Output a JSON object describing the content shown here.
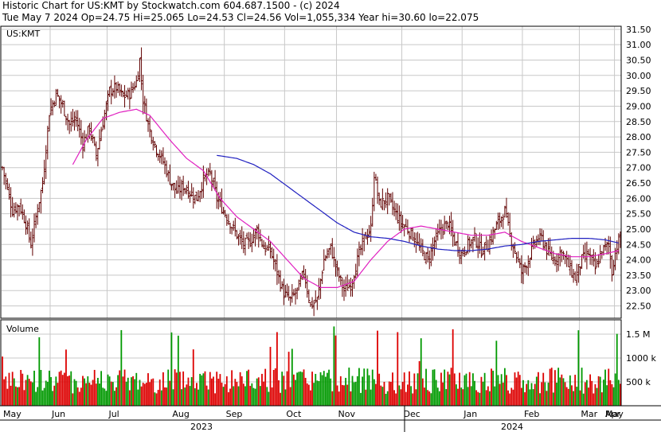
{
  "header": {
    "line1": "Historic Chart for US:KMT by Stockwatch.com 604.687.1500 - (c) 2024",
    "line2": "Tue May  7 2024   Op=24.75  Hi=25.065  Lo=24.53  Cl=24.56  Vol=1,055,334  Year hi=30.60  lo=22.075"
  },
  "symbol_label": "US:KMT",
  "volume_label": "Volume",
  "colors": {
    "price_bar": "#600000",
    "ma_short": "#e020c0",
    "ma_long": "#2020c0",
    "vol_up": "#009900",
    "vol_down": "#dd0000",
    "grid": "#c8c8c8"
  },
  "chart_data": {
    "type": "ohlc",
    "title": "Historic Chart for US:KMT",
    "y_ticks": [
      "31.50",
      "31.00",
      "30.50",
      "30.00",
      "29.50",
      "29.00",
      "28.50",
      "28.00",
      "27.50",
      "27.00",
      "26.50",
      "26.00",
      "25.50",
      "25.00",
      "24.50",
      "24.00",
      "23.50",
      "23.00",
      "22.50"
    ],
    "ylim": [
      22.1,
      31.6
    ],
    "volume_ticks": [
      "1.5 M",
      "1000 k",
      "500 k"
    ],
    "volume_ylim": [
      0,
      1800
    ],
    "x_month_labels": [
      "May",
      "Jun",
      "Jul",
      "Aug",
      "Sep",
      "Oct",
      "Nov",
      "Dec",
      "Jan",
      "Feb",
      "Mar",
      "Apr",
      "May"
    ],
    "year_labels": [
      "2023",
      "2024"
    ],
    "grid": true,
    "price_keypoints": [
      [
        0,
        27.0
      ],
      [
        6,
        25.6
      ],
      [
        10,
        25.8
      ],
      [
        14,
        25.2
      ],
      [
        17,
        24.5
      ],
      [
        20,
        25.4
      ],
      [
        24,
        26.5
      ],
      [
        28,
        28.8
      ],
      [
        32,
        29.4
      ],
      [
        36,
        29.0
      ],
      [
        40,
        28.4
      ],
      [
        44,
        28.6
      ],
      [
        48,
        27.8
      ],
      [
        52,
        28.3
      ],
      [
        56,
        27.4
      ],
      [
        60,
        28.5
      ],
      [
        64,
        29.5
      ],
      [
        68,
        29.6
      ],
      [
        72,
        29.3
      ],
      [
        76,
        29.4
      ],
      [
        80,
        29.8
      ],
      [
        82,
        30.5
      ],
      [
        84,
        29.2
      ],
      [
        88,
        28.2
      ],
      [
        92,
        27.6
      ],
      [
        96,
        27.2
      ],
      [
        100,
        26.6
      ],
      [
        104,
        26.2
      ],
      [
        108,
        26.4
      ],
      [
        112,
        26.2
      ],
      [
        116,
        26.0
      ],
      [
        120,
        26.6
      ],
      [
        124,
        26.8
      ],
      [
        128,
        26.0
      ],
      [
        132,
        25.6
      ],
      [
        136,
        25.2
      ],
      [
        140,
        24.8
      ],
      [
        144,
        24.5
      ],
      [
        148,
        24.6
      ],
      [
        152,
        25.0
      ],
      [
        156,
        24.4
      ],
      [
        160,
        24.3
      ],
      [
        164,
        23.6
      ],
      [
        168,
        22.9
      ],
      [
        172,
        22.7
      ],
      [
        176,
        23.0
      ],
      [
        180,
        23.6
      ],
      [
        184,
        22.5
      ],
      [
        188,
        22.7
      ],
      [
        192,
        24.0
      ],
      [
        196,
        24.4
      ],
      [
        200,
        23.6
      ],
      [
        204,
        23.0
      ],
      [
        208,
        23.2
      ],
      [
        212,
        24.0
      ],
      [
        216,
        24.7
      ],
      [
        220,
        25.0
      ],
      [
        222,
        26.8
      ],
      [
        225,
        25.8
      ],
      [
        230,
        26.0
      ],
      [
        234,
        25.6
      ],
      [
        238,
        25.2
      ],
      [
        242,
        25.0
      ],
      [
        246,
        24.7
      ],
      [
        250,
        24.3
      ],
      [
        254,
        24.0
      ],
      [
        258,
        24.6
      ],
      [
        262,
        25.0
      ],
      [
        266,
        25.2
      ],
      [
        270,
        24.6
      ],
      [
        274,
        24.2
      ],
      [
        278,
        24.5
      ],
      [
        282,
        24.7
      ],
      [
        286,
        24.3
      ],
      [
        290,
        24.5
      ],
      [
        294,
        25.0
      ],
      [
        298,
        25.4
      ],
      [
        300,
        25.6
      ],
      [
        303,
        24.8
      ],
      [
        306,
        24.3
      ],
      [
        310,
        23.6
      ],
      [
        314,
        24.0
      ],
      [
        318,
        24.6
      ],
      [
        322,
        24.7
      ],
      [
        326,
        24.2
      ],
      [
        330,
        24.0
      ],
      [
        334,
        24.3
      ],
      [
        338,
        23.8
      ],
      [
        342,
        23.4
      ],
      [
        346,
        24.0
      ],
      [
        350,
        24.2
      ],
      [
        354,
        23.7
      ],
      [
        358,
        24.3
      ],
      [
        362,
        24.5
      ],
      [
        364,
        23.6
      ],
      [
        366,
        24.3
      ],
      [
        368,
        24.6
      ]
    ],
    "ma_short_keypoints": [
      [
        42,
        27.1
      ],
      [
        50,
        27.9
      ],
      [
        60,
        28.6
      ],
      [
        70,
        28.8
      ],
      [
        80,
        28.9
      ],
      [
        88,
        28.7
      ],
      [
        100,
        27.9
      ],
      [
        110,
        27.3
      ],
      [
        120,
        26.9
      ],
      [
        130,
        26.0
      ],
      [
        140,
        25.4
      ],
      [
        150,
        25.0
      ],
      [
        160,
        24.6
      ],
      [
        170,
        24.0
      ],
      [
        180,
        23.4
      ],
      [
        190,
        23.1
      ],
      [
        200,
        23.1
      ],
      [
        210,
        23.3
      ],
      [
        220,
        24.0
      ],
      [
        230,
        24.6
      ],
      [
        240,
        25.0
      ],
      [
        250,
        25.1
      ],
      [
        260,
        25.0
      ],
      [
        270,
        24.9
      ],
      [
        280,
        24.8
      ],
      [
        290,
        24.8
      ],
      [
        300,
        24.9
      ],
      [
        310,
        24.6
      ],
      [
        320,
        24.4
      ],
      [
        330,
        24.2
      ],
      [
        340,
        24.1
      ],
      [
        350,
        24.1
      ],
      [
        360,
        24.2
      ],
      [
        368,
        24.3
      ]
    ],
    "ma_long_keypoints": [
      [
        128,
        27.4
      ],
      [
        140,
        27.3
      ],
      [
        150,
        27.1
      ],
      [
        160,
        26.8
      ],
      [
        170,
        26.4
      ],
      [
        180,
        26.0
      ],
      [
        190,
        25.6
      ],
      [
        200,
        25.2
      ],
      [
        210,
        24.9
      ],
      [
        220,
        24.75
      ],
      [
        230,
        24.7
      ],
      [
        240,
        24.6
      ],
      [
        250,
        24.45
      ],
      [
        260,
        24.35
      ],
      [
        270,
        24.3
      ],
      [
        280,
        24.3
      ],
      [
        290,
        24.35
      ],
      [
        300,
        24.45
      ],
      [
        310,
        24.5
      ],
      [
        320,
        24.6
      ],
      [
        330,
        24.65
      ],
      [
        340,
        24.7
      ],
      [
        350,
        24.7
      ],
      [
        360,
        24.65
      ],
      [
        368,
        24.55
      ]
    ]
  }
}
